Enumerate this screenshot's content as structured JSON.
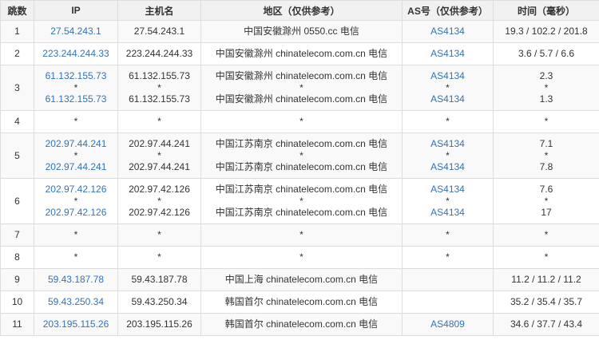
{
  "table": {
    "headers": [
      "跳数",
      "IP",
      "主机名",
      "地区（仅供参考）",
      "AS号（仅供参考）",
      "时间（毫秒）"
    ],
    "rows": [
      {
        "hop": "1",
        "ip": [
          "27.54.243.1"
        ],
        "host": [
          "27.54.243.1"
        ],
        "region": [
          "中国安徽滁州 0550.cc 电信"
        ],
        "as": [
          "AS4134"
        ],
        "time": [
          "19.3 / 102.2 / 201.8"
        ]
      },
      {
        "hop": "2",
        "ip": [
          "223.244.244.33"
        ],
        "host": [
          "223.244.244.33"
        ],
        "region": [
          "中国安徽滁州 chinatelecom.com.cn 电信"
        ],
        "as": [
          "AS4134"
        ],
        "time": [
          "3.6 / 5.7 / 6.6"
        ]
      },
      {
        "hop": "3",
        "ip": [
          "61.132.155.73",
          "*",
          "61.132.155.73"
        ],
        "host": [
          "61.132.155.73",
          "*",
          "61.132.155.73"
        ],
        "region": [
          "中国安徽滁州 chinatelecom.com.cn 电信",
          "*",
          "中国安徽滁州 chinatelecom.com.cn 电信"
        ],
        "as": [
          "AS4134",
          "*",
          "AS4134"
        ],
        "time": [
          "2.3",
          "*",
          "1.3"
        ]
      },
      {
        "hop": "4",
        "ip": [
          "*"
        ],
        "host": [
          "*"
        ],
        "region": [
          "*"
        ],
        "as": [
          "*"
        ],
        "time": [
          "*"
        ]
      },
      {
        "hop": "5",
        "ip": [
          "202.97.44.241",
          "*",
          "202.97.44.241"
        ],
        "host": [
          "202.97.44.241",
          "*",
          "202.97.44.241"
        ],
        "region": [
          "中国江苏南京 chinatelecom.com.cn 电信",
          "*",
          "中国江苏南京 chinatelecom.com.cn 电信"
        ],
        "as": [
          "AS4134",
          "*",
          "AS4134"
        ],
        "time": [
          "7.1",
          "*",
          "7.8"
        ]
      },
      {
        "hop": "6",
        "ip": [
          "202.97.42.126",
          "*",
          "202.97.42.126"
        ],
        "host": [
          "202.97.42.126",
          "*",
          "202.97.42.126"
        ],
        "region": [
          "中国江苏南京 chinatelecom.com.cn 电信",
          "*",
          "中国江苏南京 chinatelecom.com.cn 电信"
        ],
        "as": [
          "AS4134",
          "*",
          "AS4134"
        ],
        "time": [
          "7.6",
          "*",
          "17"
        ]
      },
      {
        "hop": "7",
        "ip": [
          "*"
        ],
        "host": [
          "*"
        ],
        "region": [
          "*"
        ],
        "as": [
          "*"
        ],
        "time": [
          "*"
        ]
      },
      {
        "hop": "8",
        "ip": [
          "*"
        ],
        "host": [
          "*"
        ],
        "region": [
          "*"
        ],
        "as": [
          "*"
        ],
        "time": [
          "*"
        ]
      },
      {
        "hop": "9",
        "ip": [
          "59.43.187.78"
        ],
        "host": [
          "59.43.187.78"
        ],
        "region": [
          "中国上海 chinatelecom.com.cn 电信"
        ],
        "as": [
          ""
        ],
        "time": [
          "11.2 / 11.2 / 11.2"
        ]
      },
      {
        "hop": "10",
        "ip": [
          "59.43.250.34"
        ],
        "host": [
          "59.43.250.34"
        ],
        "region": [
          "韩国首尔 chinatelecom.com.cn 电信"
        ],
        "as": [
          ""
        ],
        "time": [
          "35.2 / 35.4 / 35.7"
        ]
      },
      {
        "hop": "11",
        "ip": [
          "203.195.115.26"
        ],
        "host": [
          "203.195.115.26"
        ],
        "region": [
          "韩国首尔 chinatelecom.com.cn 电信"
        ],
        "as": [
          "AS4809"
        ],
        "time": [
          "34.6 / 37.7 / 43.4"
        ]
      }
    ]
  },
  "colors": {
    "link": "#3273b8",
    "border": "#dddddd",
    "header_bg": "#f1f1f1",
    "odd_row_bg": "#f9f9f9"
  }
}
